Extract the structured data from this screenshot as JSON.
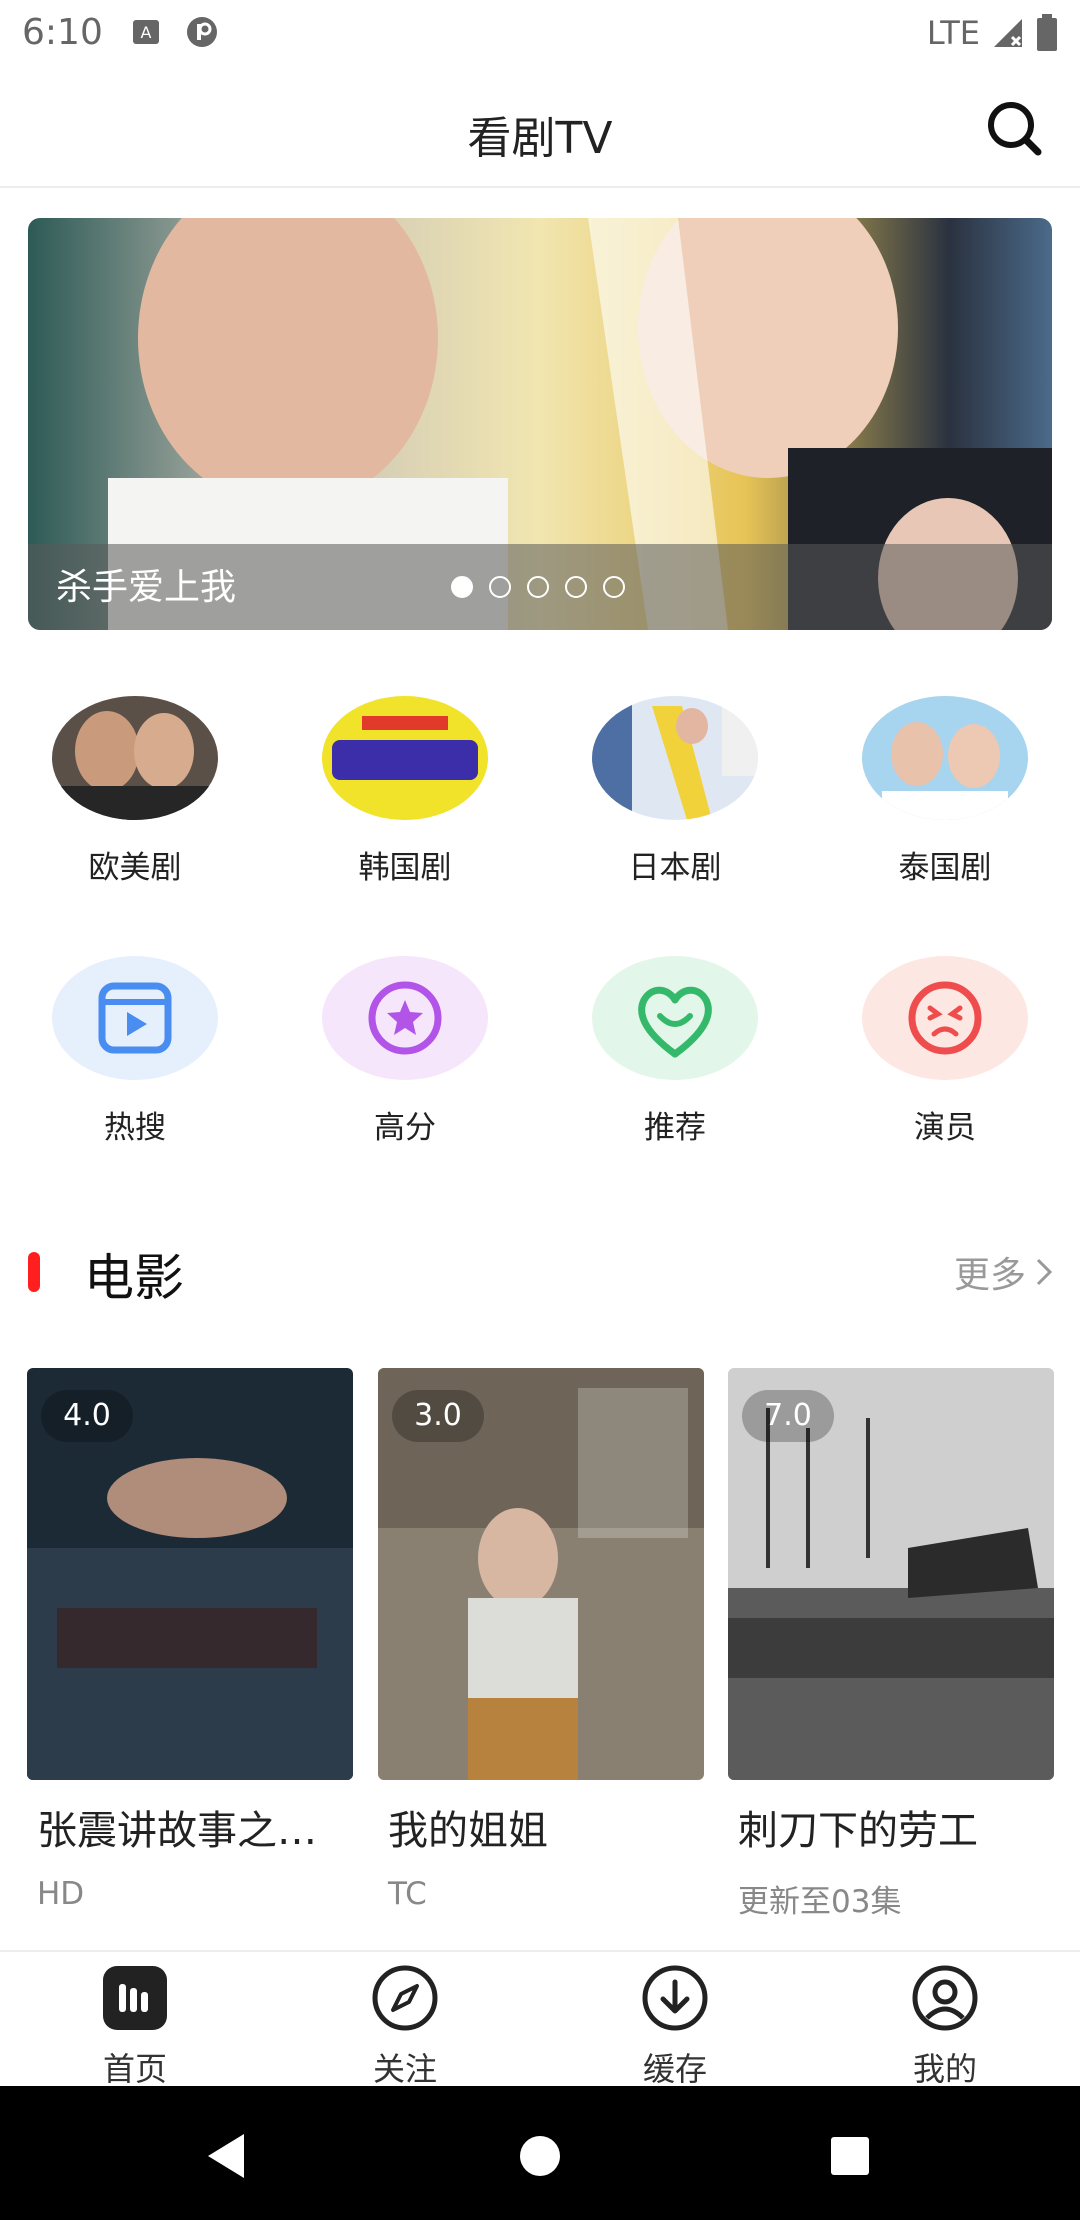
{
  "status_bar": {
    "time": "6:10",
    "network": "LTE"
  },
  "header": {
    "title": "看剧TV",
    "search_icon": "search-icon"
  },
  "banner": {
    "caption": "杀手爱上我",
    "dot_count": 5,
    "active_index": 0
  },
  "regions": [
    {
      "label": "欧美剧"
    },
    {
      "label": "韩国剧"
    },
    {
      "label": "日本剧"
    },
    {
      "label": "泰国剧"
    }
  ],
  "features": [
    {
      "label": "热搜",
      "icon": "video-icon",
      "color": "#4a8df0"
    },
    {
      "label": "高分",
      "icon": "star-icon",
      "color": "#b254e8"
    },
    {
      "label": "推荐",
      "icon": "heart-smile-icon",
      "color": "#34b96a"
    },
    {
      "label": "演员",
      "icon": "face-icon",
      "color": "#ef4d4d"
    }
  ],
  "movie_section": {
    "title": "电影",
    "more_label": "更多"
  },
  "movies": [
    {
      "title": "张震讲故事之…",
      "sub": "HD",
      "rating": "4.0"
    },
    {
      "title": "我的姐姐",
      "sub": "TC",
      "rating": "3.0"
    },
    {
      "title": "刺刀下的劳工",
      "sub": "更新至03集",
      "rating": "7.0"
    }
  ],
  "tabs": [
    {
      "label": "首页",
      "icon": "home-icon",
      "active": true
    },
    {
      "label": "关注",
      "icon": "compass-icon",
      "active": false
    },
    {
      "label": "缓存",
      "icon": "download-icon",
      "active": false
    },
    {
      "label": "我的",
      "icon": "profile-icon",
      "active": false
    }
  ]
}
